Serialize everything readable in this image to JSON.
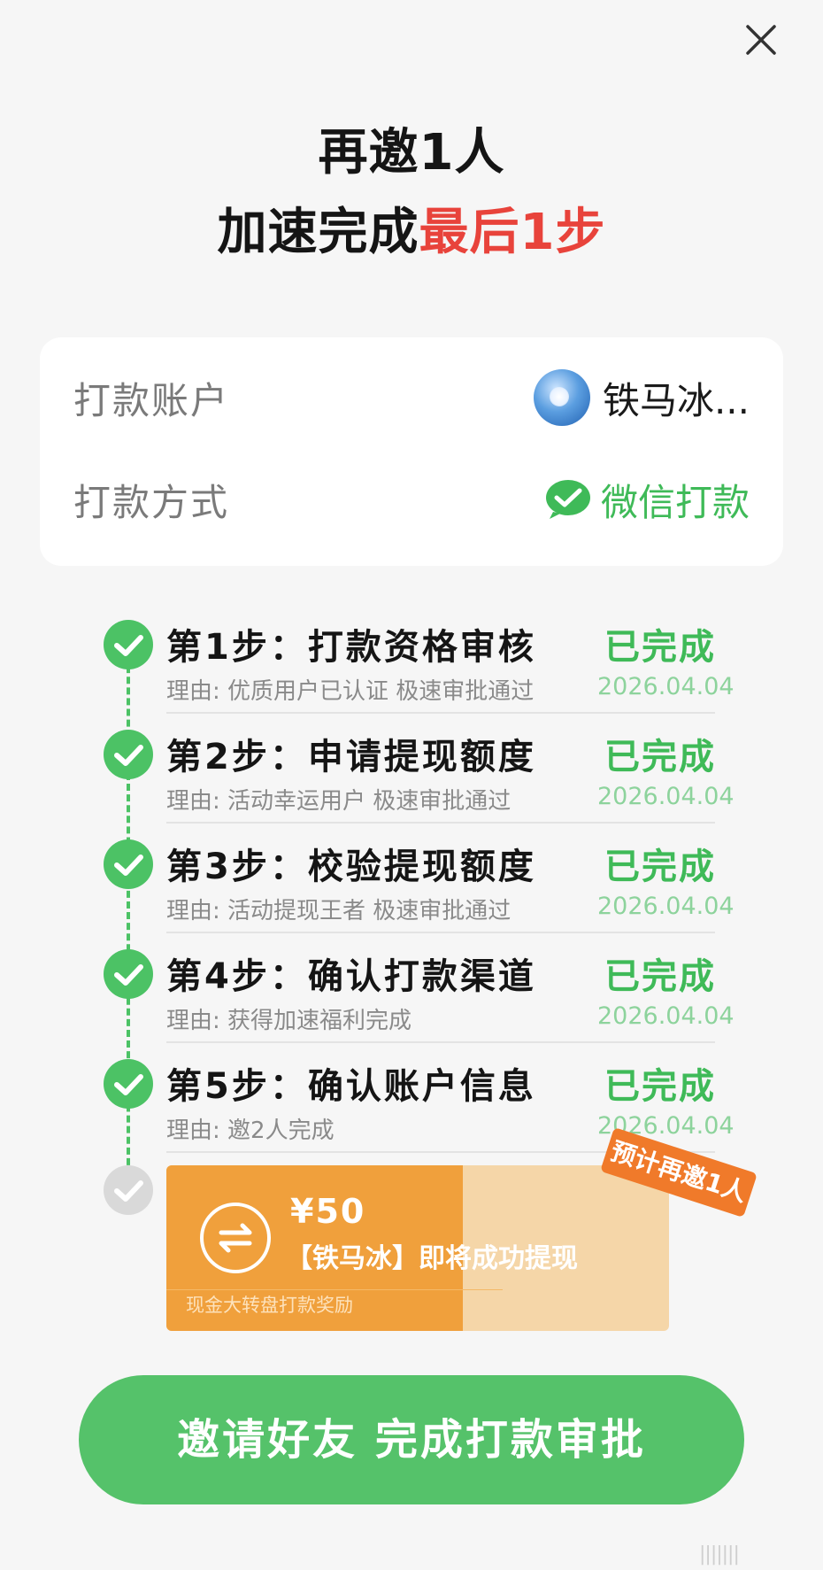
{
  "header": {
    "line1": "再邀1人",
    "line2_prefix": "加速完成",
    "line2_highlight": "最后1步"
  },
  "account": {
    "account_label": "打款账户",
    "account_name": "铁马冰...",
    "method_label": "打款方式",
    "method_value": "微信打款"
  },
  "steps": [
    {
      "title": "第1步：打款资格审核",
      "reason": "理由: 优质用户已认证 极速审批通过",
      "status": "已完成",
      "date": "2026.04.04"
    },
    {
      "title": "第2步：申请提现额度",
      "reason": "理由: 活动幸运用户 极速审批通过",
      "status": "已完成",
      "date": "2026.04.04"
    },
    {
      "title": "第3步：校验提现额度",
      "reason": "理由: 活动提现王者 极速审批通过",
      "status": "已完成",
      "date": "2026.04.04"
    },
    {
      "title": "第4步：确认打款渠道",
      "reason": "理由: 获得加速福利完成",
      "status": "已完成",
      "date": "2026.04.04"
    },
    {
      "title": "第5步：确认账户信息",
      "reason": "理由: 邀2人完成",
      "status": "已完成",
      "date": "2026.04.04"
    }
  ],
  "reward": {
    "amount": "¥50",
    "text": "【铁马冰】即将成功提现",
    "footer": "现金大转盘打款奖励",
    "badge": "预计再邀1人",
    "progress": 0.59
  },
  "cta": {
    "label": "邀请好友 完成打款审批"
  },
  "colors": {
    "green": "#4cc265",
    "red": "#e8433b",
    "orange": "#f0a03c"
  },
  "watermark": "|||||||"
}
